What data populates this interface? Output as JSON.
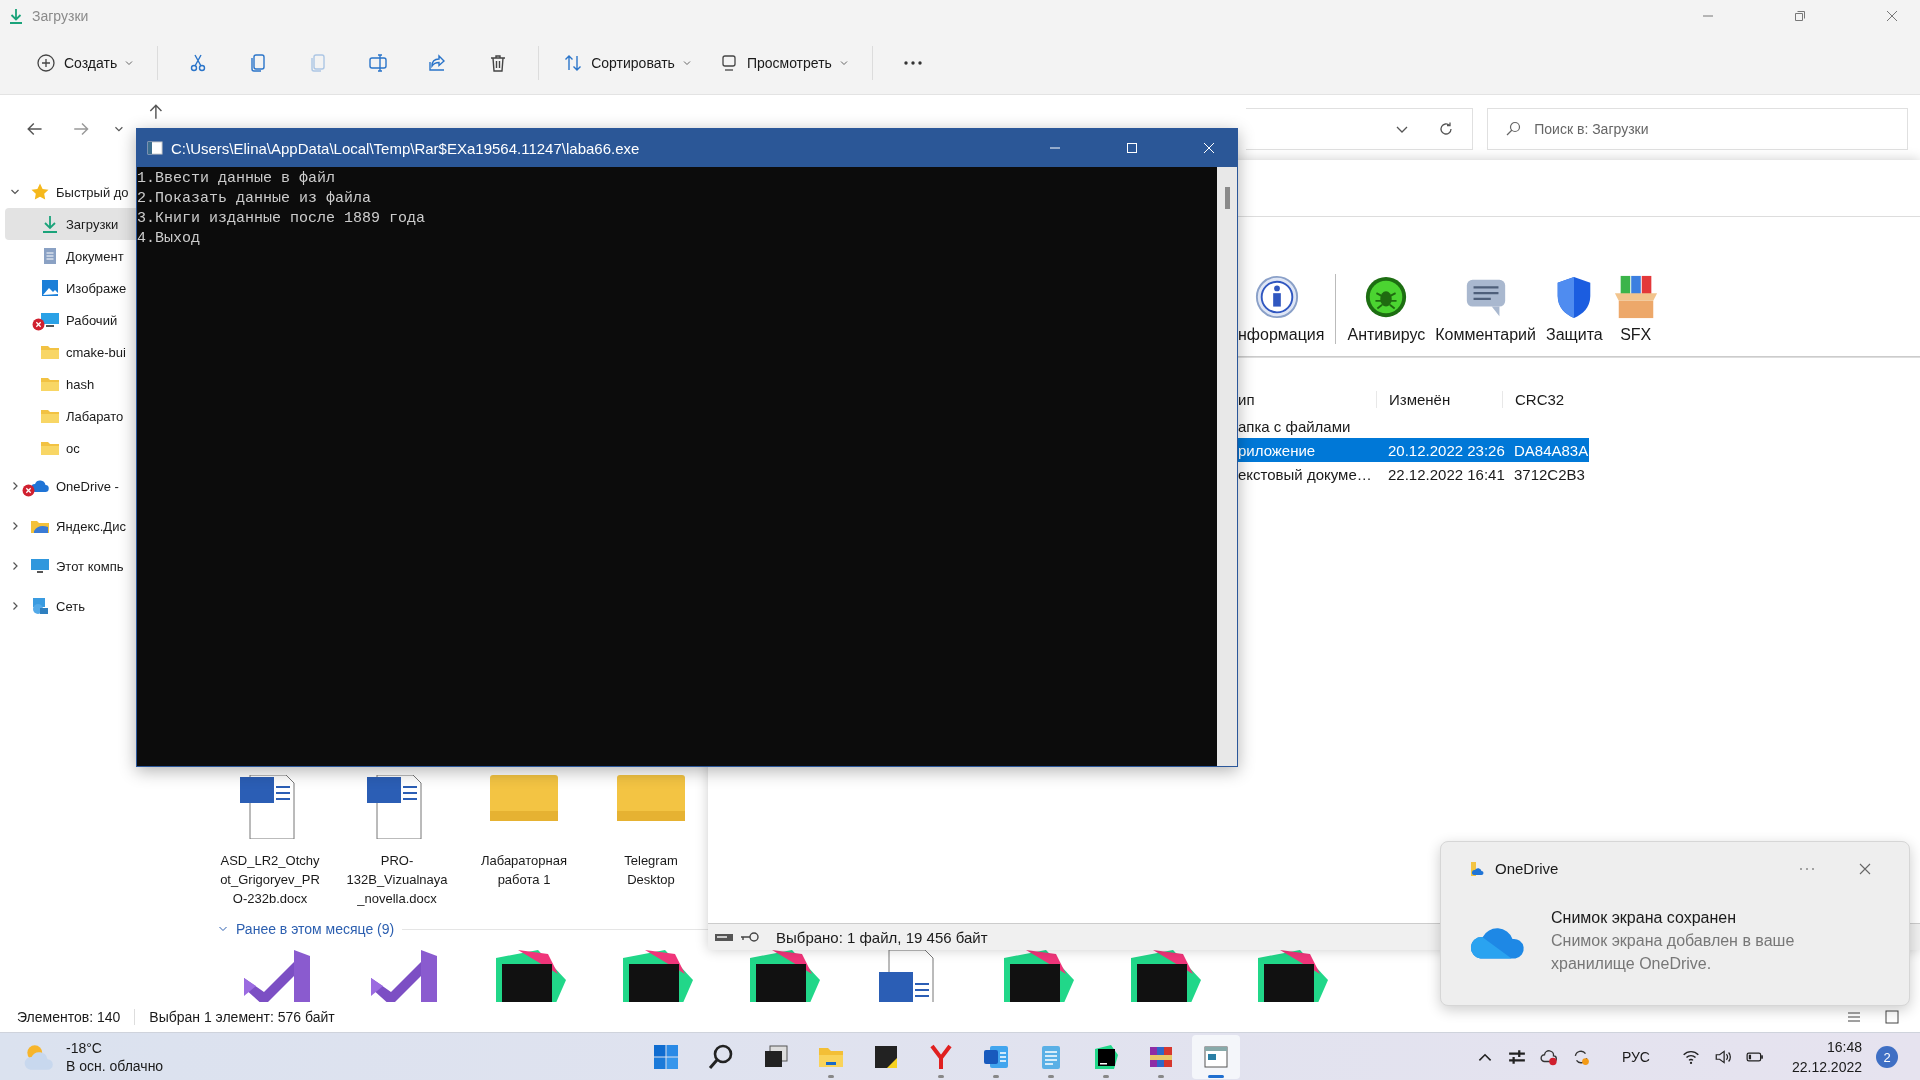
{
  "explorer": {
    "title": "Загрузки",
    "toolbar": [
      {
        "kind": "new",
        "label": "Создать",
        "dropdown": true,
        "disabled": false
      },
      {
        "kind": "cut",
        "disabled": false
      },
      {
        "kind": "copy",
        "disabled": false
      },
      {
        "kind": "paste",
        "disabled": true
      },
      {
        "kind": "rename",
        "disabled": false
      },
      {
        "kind": "share",
        "disabled": false
      },
      {
        "kind": "delete",
        "disabled": false
      },
      {
        "kind": "sort",
        "label": "Сортировать",
        "dropdown": true,
        "disabled": false
      },
      {
        "kind": "view",
        "label": "Просмотреть",
        "dropdown": true,
        "disabled": false
      },
      {
        "kind": "more",
        "disabled": false
      }
    ],
    "search": {
      "placeholder": "Поиск в: Загрузки"
    },
    "sidebar": [
      {
        "label": "Быстрый до",
        "kind": "star",
        "expanded": true,
        "selected": false,
        "error": false,
        "children": [
          {
            "label": "Загрузки",
            "kind": "download",
            "selected": true,
            "error": false
          },
          {
            "label": "Документ",
            "kind": "document",
            "selected": false,
            "error": false
          },
          {
            "label": "Изображе",
            "kind": "image",
            "selected": false,
            "error": false
          },
          {
            "label": "Рабочий",
            "kind": "desktop",
            "selected": false,
            "error": true
          },
          {
            "label": "cmake-bui",
            "kind": "folder",
            "selected": false,
            "error": false
          },
          {
            "label": "hash",
            "kind": "folder",
            "selected": false,
            "error": false
          },
          {
            "label": "Лабарато",
            "kind": "folder",
            "selected": false,
            "error": false
          },
          {
            "label": "ос",
            "kind": "folder",
            "selected": false,
            "error": false
          }
        ]
      },
      {
        "label": "OneDrive -",
        "kind": "cloud",
        "expanded": false,
        "selected": false,
        "error": true
      },
      {
        "label": "Яндекс.Дис",
        "kind": "yandex",
        "expanded": false,
        "selected": false,
        "error": false
      },
      {
        "label": "Этот компь",
        "kind": "computer",
        "expanded": false,
        "selected": false,
        "error": false
      },
      {
        "label": "Сеть",
        "kind": "network",
        "expanded": false,
        "selected": false,
        "error": false
      }
    ],
    "files": [
      {
        "name": "ASD_LR2_Otchyot_Grigoryev_PRO-232b.docx",
        "kind": "word"
      },
      {
        "name": "PRO-132B_Vizualnaya_novella.docx",
        "kind": "word"
      },
      {
        "name": "Лабараторная работа 1",
        "kind": "folder"
      },
      {
        "name": "Telegram Desktop",
        "kind": "folder"
      }
    ],
    "group": {
      "label": "Ранее в этом месяце (9)",
      "expanded": true
    },
    "group_files": [
      {
        "kind": "vs"
      },
      {
        "kind": "vs"
      },
      {
        "kind": "clion"
      },
      {
        "kind": "clion"
      },
      {
        "kind": "clion"
      },
      {
        "kind": "word"
      },
      {
        "kind": "clion"
      },
      {
        "kind": "clion"
      },
      {
        "kind": "clion"
      }
    ],
    "status_bar": {
      "count": "Элементов: 140",
      "selection": "Выбран 1 элемент: 576 байт"
    }
  },
  "console": {
    "title": "C:\\Users\\Elina\\AppData\\Local\\Temp\\Rar$EXa19564.11247\\laba66.exe",
    "lines": [
      "1.Ввести данные в файл",
      "2.Показать данные из файла",
      "3.Книги изданные после 1889 года",
      "4.Выход"
    ]
  },
  "archiver": {
    "tools": [
      {
        "label": "нформация",
        "kind": "info"
      },
      {
        "label": "Антивирус",
        "kind": "antivirus"
      },
      {
        "label": "Комментарий",
        "kind": "comment"
      },
      {
        "label": "Защита",
        "kind": "protect"
      },
      {
        "label": "SFX",
        "kind": "sfx"
      }
    ],
    "columns": [
      "ип",
      "Изменён",
      "CRC32"
    ],
    "rows": [
      {
        "cells": [
          "апка с файлами",
          "",
          ""
        ],
        "selected": false
      },
      {
        "cells": [
          "риложение",
          "20.12.2022 23:26",
          "DA84A83A"
        ],
        "selected": true
      },
      {
        "cells": [
          "екстовый докуме…",
          "22.12.2022 16:41",
          "3712C2B3"
        ],
        "selected": false
      }
    ],
    "status": "Выбрано: 1 файл, 19 456 байт"
  },
  "notification": {
    "app": "OneDrive",
    "title": "Снимок экрана сохранен",
    "body": "Снимок экрана добавлен в ваше хранилище OneDrive."
  },
  "taskbar": {
    "weather": {
      "temperature": "-18°C",
      "description": "В осн. облачно"
    },
    "apps": [
      {
        "kind": "start",
        "running": false,
        "selected": false
      },
      {
        "kind": "search",
        "running": false,
        "selected": false
      },
      {
        "kind": "taskview",
        "running": false,
        "selected": false
      },
      {
        "kind": "explorer",
        "running": true,
        "selected": false
      },
      {
        "kind": "notes",
        "running": false,
        "selected": false
      },
      {
        "kind": "yandex",
        "running": true,
        "selected": false
      },
      {
        "kind": "word",
        "running": true,
        "selected": false
      },
      {
        "kind": "notepad",
        "running": true,
        "selected": false
      },
      {
        "kind": "clion",
        "running": true,
        "selected": false
      },
      {
        "kind": "winrar",
        "running": true,
        "selected": false
      },
      {
        "kind": "console",
        "running": true,
        "selected": true
      }
    ],
    "language": "РУС",
    "time": "16:48",
    "date": "22.12.2022",
    "notifications": "2"
  }
}
